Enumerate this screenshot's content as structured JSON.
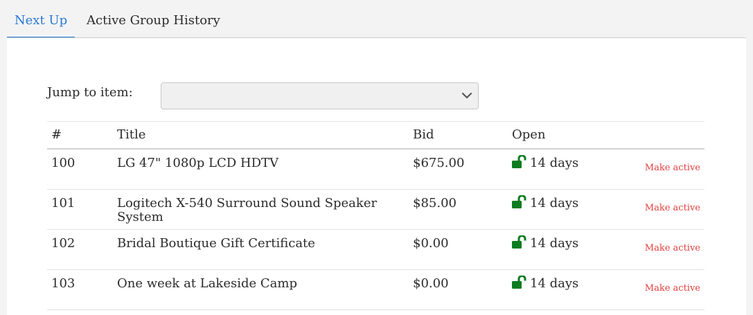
{
  "tabs": [
    {
      "label": "Next Up"
    },
    {
      "label": "Active Group History"
    }
  ],
  "jump": {
    "label": "Jump to item:",
    "value": ""
  },
  "table": {
    "headers": [
      "#",
      "Title",
      "Bid",
      "Open",
      ""
    ],
    "rows": [
      {
        "num": "100",
        "title": "LG 47\" 1080p LCD HDTV",
        "bid": "$675.00",
        "open": "14 days",
        "action": "Make active"
      },
      {
        "num": "101",
        "title": "Logitech X-540 Surround Sound Speaker System",
        "bid": "$85.00",
        "open": "14 days",
        "action": "Make active"
      },
      {
        "num": "102",
        "title": "Bridal Boutique Gift Certificate",
        "bid": "$0.00",
        "open": "14 days",
        "action": "Make active"
      },
      {
        "num": "103",
        "title": "One week at Lakeside Camp",
        "bid": "$0.00",
        "open": "14 days",
        "action": "Make active"
      }
    ]
  },
  "icons": {
    "open_status": "unlocked-padlock-icon",
    "dropdown": "chevron-down-icon"
  },
  "colors": {
    "accent": "#2a7ad2",
    "action": "#e0413e",
    "unlocked": "#0b7d1f"
  }
}
